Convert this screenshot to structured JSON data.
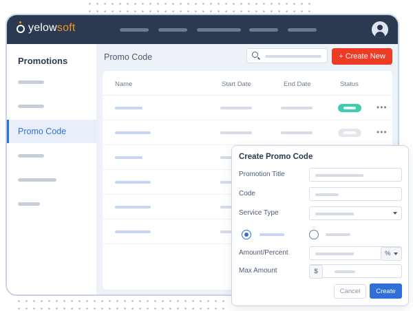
{
  "app": {
    "logo_text_a": "yelow",
    "logo_text_b": "soft",
    "brand_colors": {
      "primary": "#2f6fd8",
      "accent": "#f7931e",
      "danger": "#ee3b24",
      "success": "#3fcbad",
      "topbar": "#2b3a50"
    }
  },
  "topbar": {
    "nav_items": 5,
    "avatar_icon": "user-avatar-icon"
  },
  "sidebar": {
    "title": "Promotions",
    "active_item": "Promo Code"
  },
  "main": {
    "title": "Promo Code",
    "search_icon": "search-icon",
    "create_new_label": "+ Create New",
    "columns": [
      "Name",
      "Start Date",
      "End Date",
      "Status"
    ],
    "rows": [
      {
        "status": "active"
      },
      {
        "status": "inactive"
      },
      {},
      {},
      {},
      {}
    ]
  },
  "modal": {
    "title": "Create Promo Code",
    "fields": {
      "promotion_title": "Promotion Title",
      "code": "Code",
      "service_type": "Service Type",
      "amount_percent": "Amount/Percent",
      "max_amount": "Max Amount"
    },
    "percent_unit": "%",
    "currency_unit": "$",
    "cancel_label": "Cancel",
    "create_label": "Create"
  }
}
